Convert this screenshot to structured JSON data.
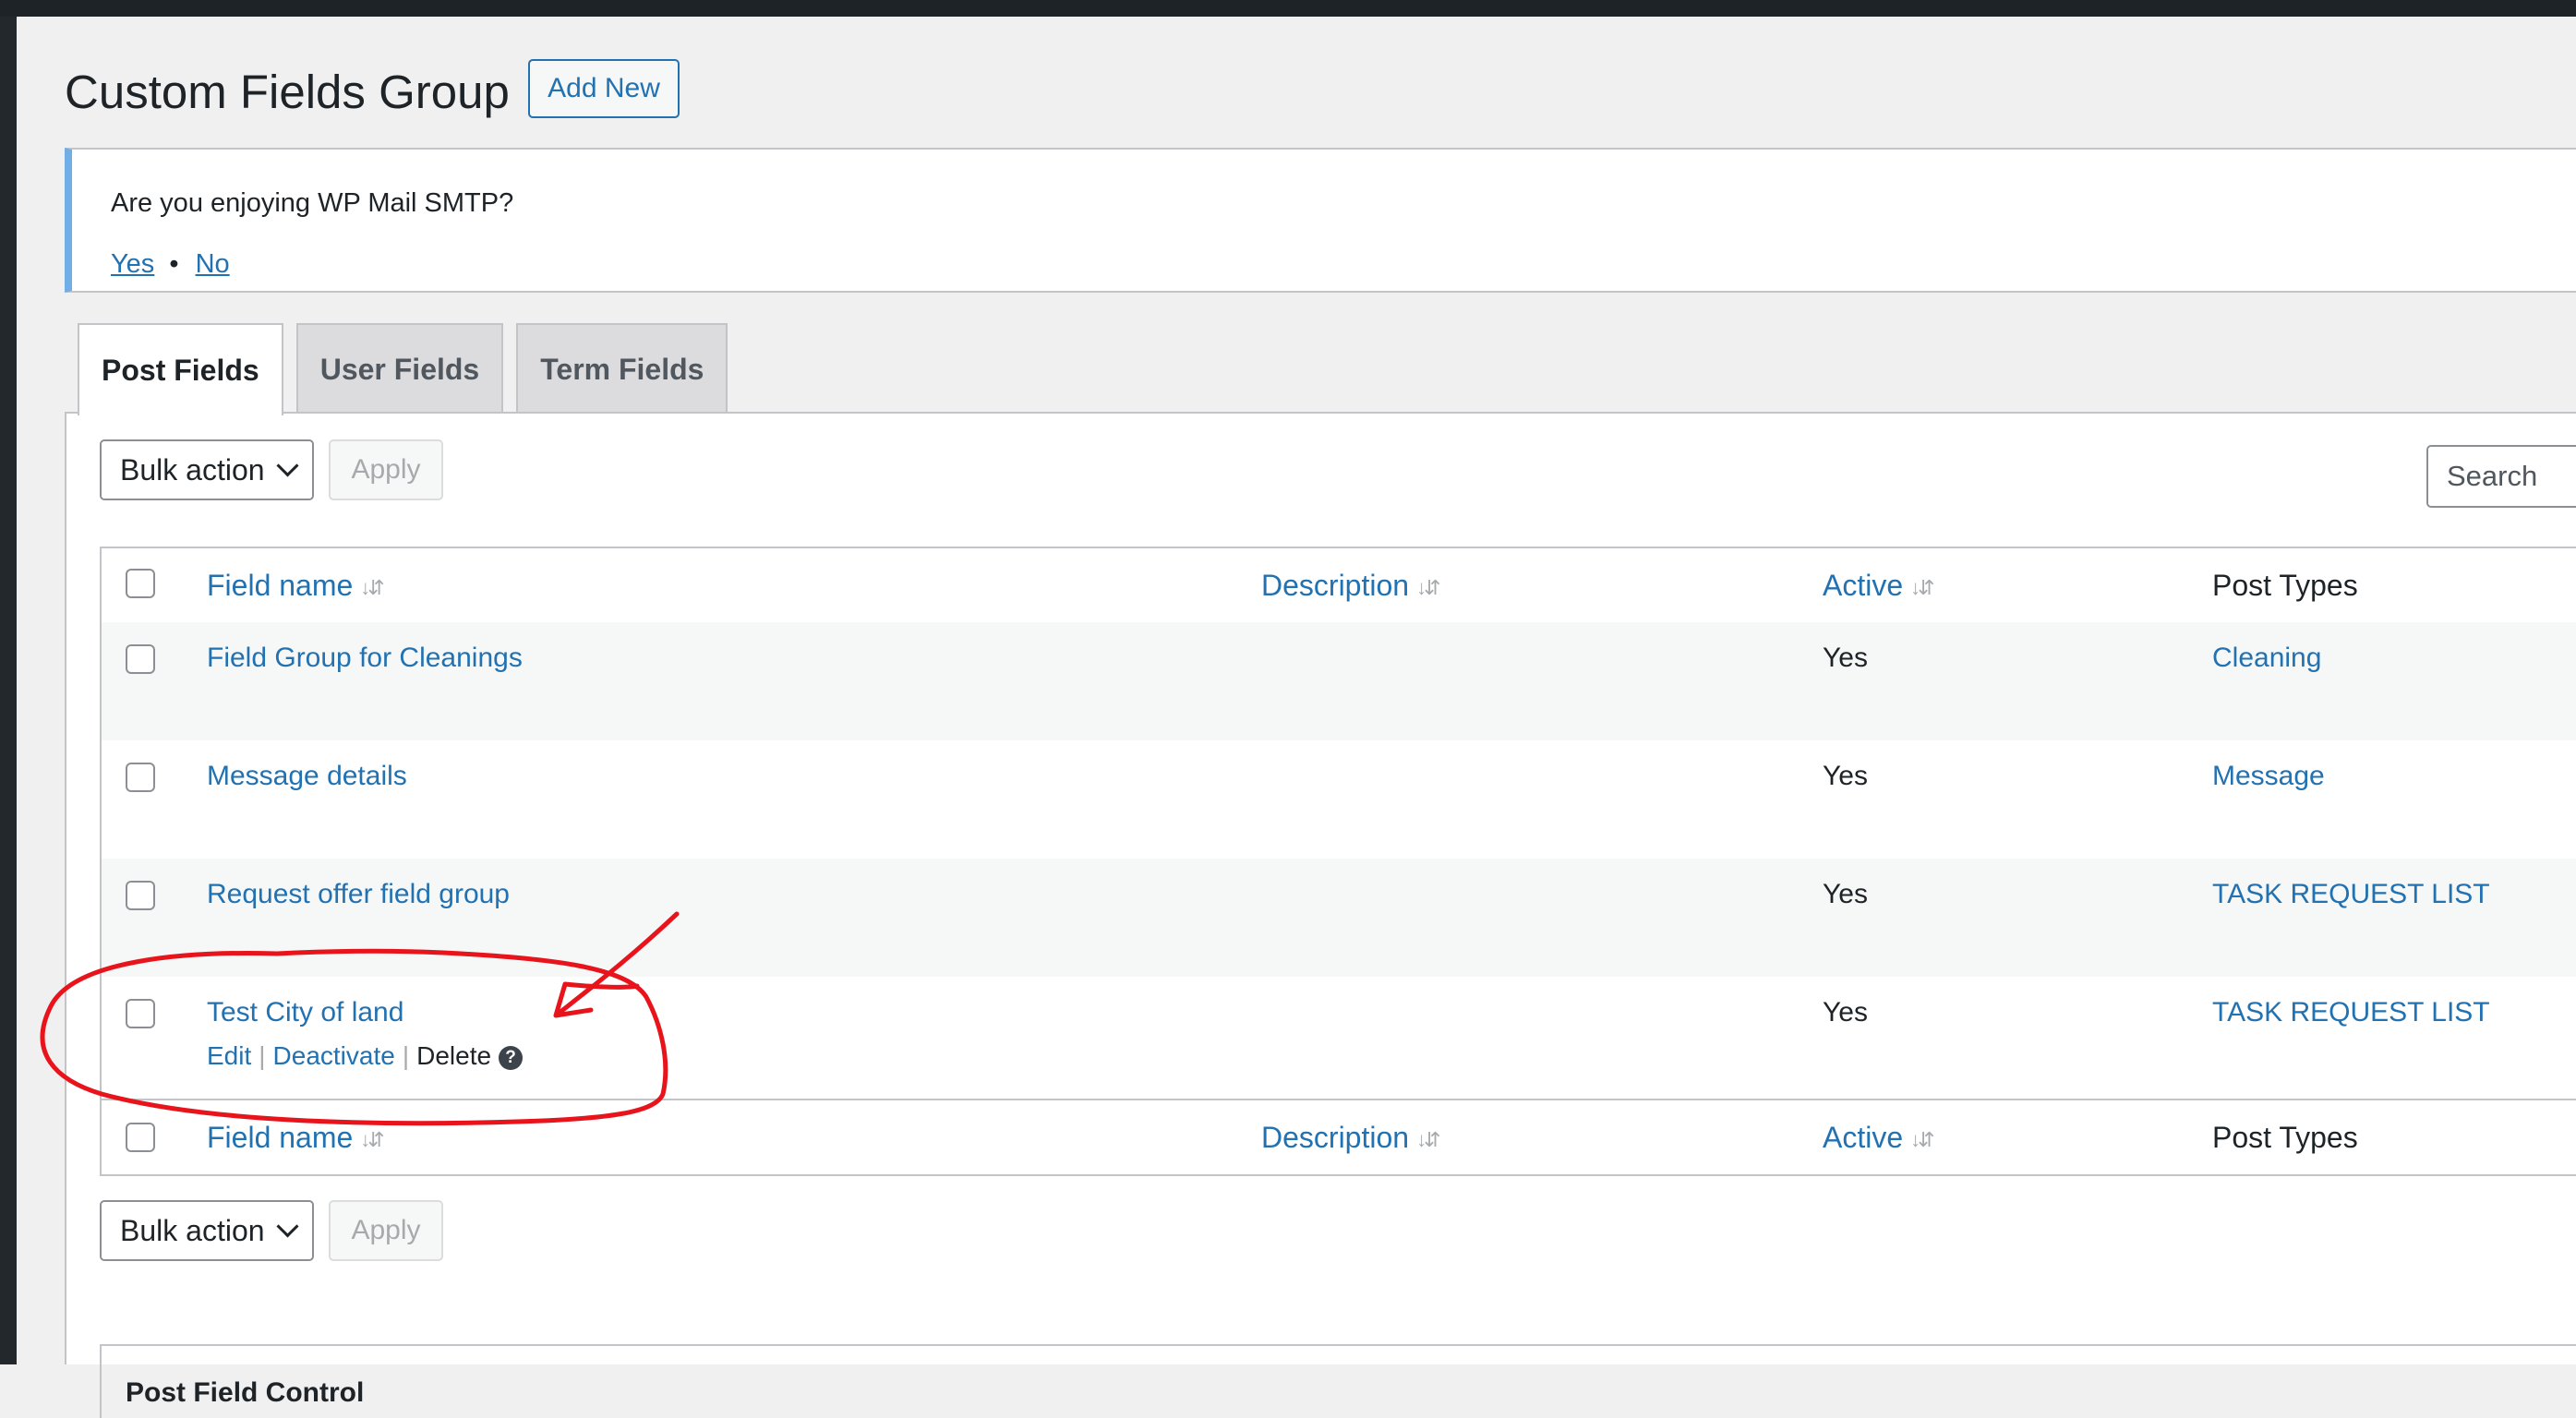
{
  "page": {
    "title": "Custom Fields Group",
    "add_new_label": "Add New"
  },
  "notice": {
    "question": "Are you enjoying WP Mail SMTP?",
    "yes": "Yes",
    "separator": "•",
    "no": "No"
  },
  "tabs": [
    {
      "label": "Post Fields",
      "active": true
    },
    {
      "label": "User Fields",
      "active": false
    },
    {
      "label": "Term Fields",
      "active": false
    }
  ],
  "toolbar": {
    "bulk_action": "Bulk action",
    "apply": "Apply",
    "search_placeholder": "Search"
  },
  "table": {
    "columns": {
      "field_name": "Field name",
      "description": "Description",
      "active": "Active",
      "post_types": "Post Types"
    },
    "rows": [
      {
        "name": "Field Group for Cleanings",
        "description": "",
        "active": "Yes",
        "post_types": "Cleaning"
      },
      {
        "name": "Message details",
        "description": "",
        "active": "Yes",
        "post_types": "Message"
      },
      {
        "name": "Request offer field group",
        "description": "",
        "active": "Yes",
        "post_types": "TASK REQUEST LIST"
      },
      {
        "name": "Test City of land",
        "description": "",
        "active": "Yes",
        "post_types": "TASK REQUEST LIST"
      }
    ],
    "row_actions": {
      "edit": "Edit",
      "deactivate": "Deactivate",
      "delete": "Delete",
      "separator": "|",
      "help_glyph": "?"
    }
  },
  "control_section": {
    "title": "Post Field Control"
  },
  "colors": {
    "link": "#2271b1",
    "annotation": "#e8141c",
    "notice_border": "#72aee6"
  }
}
